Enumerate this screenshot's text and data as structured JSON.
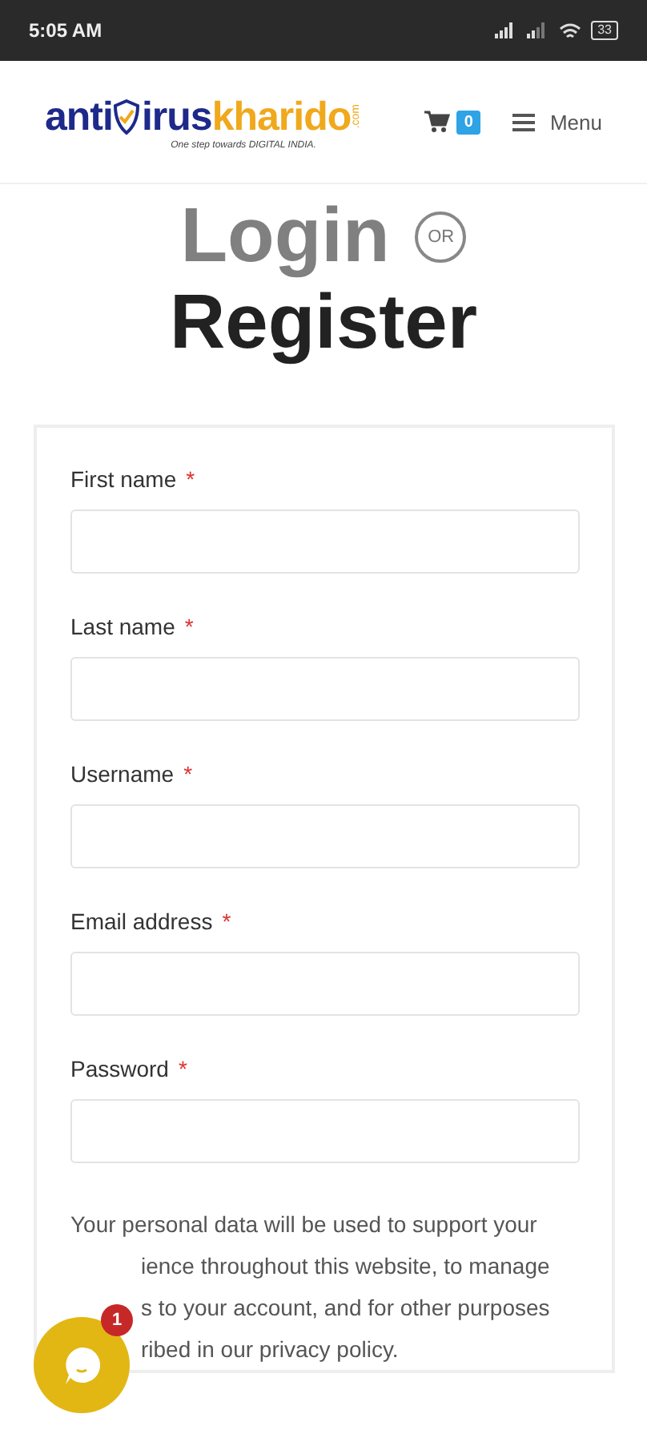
{
  "status_bar": {
    "time": "5:05 AM",
    "battery": "33"
  },
  "header": {
    "logo": {
      "part_1": "anti",
      "part_2": "irus",
      "part_3": "kharido",
      "part_4": ".com",
      "tagline": "One step towards DIGITAL INDIA."
    },
    "cart_count": "0",
    "menu_label": "Menu"
  },
  "title": {
    "login": "Login",
    "or": "OR",
    "register": "Register"
  },
  "form": {
    "fields": [
      {
        "label": "First name",
        "marker": "*"
      },
      {
        "label": "Last name",
        "marker": "*"
      },
      {
        "label": "Username",
        "marker": "*"
      },
      {
        "label": "Email address",
        "marker": "*"
      },
      {
        "label": "Password",
        "marker": "*"
      }
    ],
    "privacy_lines": [
      "Your personal data will be used to support your",
      "ience throughout this website, to manage",
      "s to your account, and for other purposes",
      "ribed in our privacy policy."
    ]
  },
  "chat": {
    "unread": "1"
  }
}
